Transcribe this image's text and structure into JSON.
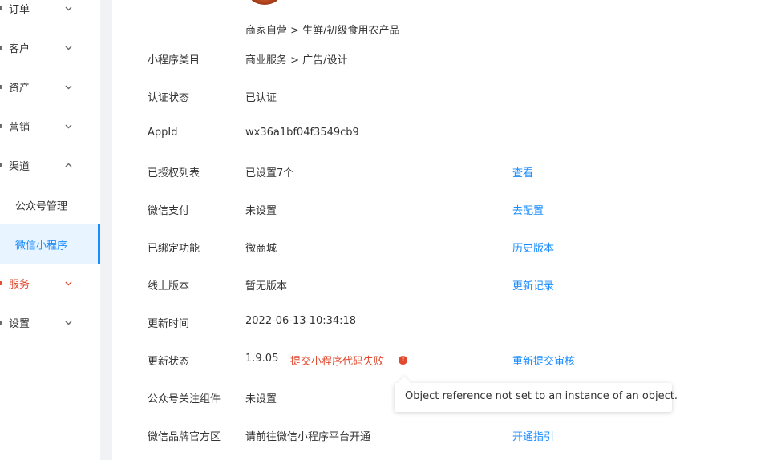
{
  "sidebar": {
    "items": [
      {
        "label": "订单",
        "icon": "order-icon",
        "chevron": "down"
      },
      {
        "label": "客户",
        "icon": "customer-icon",
        "chevron": "down"
      },
      {
        "label": "资产",
        "icon": "asset-icon",
        "chevron": "down"
      },
      {
        "label": "营销",
        "icon": "marketing-icon",
        "chevron": "down"
      },
      {
        "label": "渠道",
        "icon": "channel-icon",
        "chevron": "up"
      },
      {
        "label": "服务",
        "icon": "service-icon",
        "chevron": "down"
      },
      {
        "label": "设置",
        "icon": "settings-icon",
        "chevron": "down"
      }
    ],
    "sub_items": [
      {
        "label": "公众号管理"
      },
      {
        "label": "微信小程序",
        "active": true
      }
    ]
  },
  "profile": {
    "category_path": "商家自营 > 生鲜/初级食用农产品"
  },
  "details": [
    {
      "key": "小程序类目",
      "value": "商业服务 > 广告/设计",
      "action": ""
    },
    {
      "key": "认证状态",
      "value": "已认证",
      "action": ""
    },
    {
      "key": "AppId",
      "value": "wx36a1bf04f3549cb9",
      "action": ""
    },
    {
      "key": "已授权列表",
      "value": "已设置7个",
      "action": "查看"
    },
    {
      "key": "微信支付",
      "value": "未设置",
      "action": "去配置"
    },
    {
      "key": "已绑定功能",
      "value": "微商城",
      "action": "历史版本"
    },
    {
      "key": "线上版本",
      "value": "暂无版本",
      "action": "更新记录"
    },
    {
      "key": "更新时间",
      "value": "2022-06-13 10:34:18",
      "action": ""
    },
    {
      "key": "更新状态",
      "value": "1.9.05",
      "action": "重新提交审核"
    },
    {
      "key": "公众号关注组件",
      "value": "未设置",
      "action": ""
    },
    {
      "key": "微信品牌官方区",
      "value": "请前往微信小程序平台开通",
      "action": "开通指引"
    }
  ],
  "update_error": {
    "text": "提交小程序代码失败",
    "icon": "error-info-icon",
    "tooltip": "Object reference not set to an instance of an object."
  },
  "colors": {
    "accent": "#1a8cff",
    "error": "#e0492e"
  }
}
